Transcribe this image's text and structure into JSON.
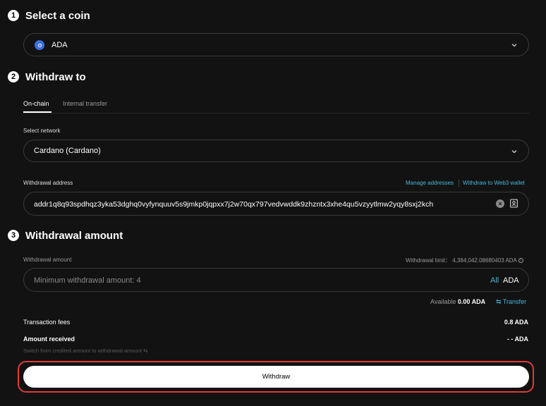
{
  "step1": {
    "num": "1",
    "title": "Select a coin"
  },
  "coin": {
    "symbol": "ADA",
    "icon_color": "#3d6fd9"
  },
  "step2": {
    "num": "2",
    "title": "Withdraw to"
  },
  "tabs": [
    {
      "label": "On-chain",
      "active": true
    },
    {
      "label": "Internal transfer",
      "active": false
    }
  ],
  "network": {
    "label": "Select network",
    "value": "Cardano (Cardano)"
  },
  "address": {
    "label": "Withdrawal address",
    "manage_link": "Manage addresses",
    "web3_link": "Withdraw to Web3 wallet",
    "value": "addr1q8q93spdhqz3yka53dghq0vyfynquuv5s9jmkp0jqpxx7j2w70qx797vedvwddk9zhzntx3xhe4qu5vzyytlmw2yqy8sxj2kch"
  },
  "step3": {
    "num": "3",
    "title": "Withdrawal amount"
  },
  "amount": {
    "label": "Withdrawal amount",
    "limit_label": "Withdrawal limit：",
    "limit_value": "4,384,042.08680403 ADA",
    "placeholder": "Minimum withdrawal amount: 4",
    "all_label": "All",
    "unit": "ADA",
    "available_label": "Available",
    "available_value": "0.00 ADA",
    "transfer_label": "Transfer"
  },
  "fees": {
    "label": "Transaction fees",
    "value": "0.8 ADA"
  },
  "received": {
    "label": "Amount received",
    "value": "- - ADA"
  },
  "switch_text": "Switch from credited amount to withdrawal amount",
  "submit_label": "Withdraw",
  "colors": {
    "accent": "#4ab5d8",
    "highlight_border": "#e03a3a"
  }
}
